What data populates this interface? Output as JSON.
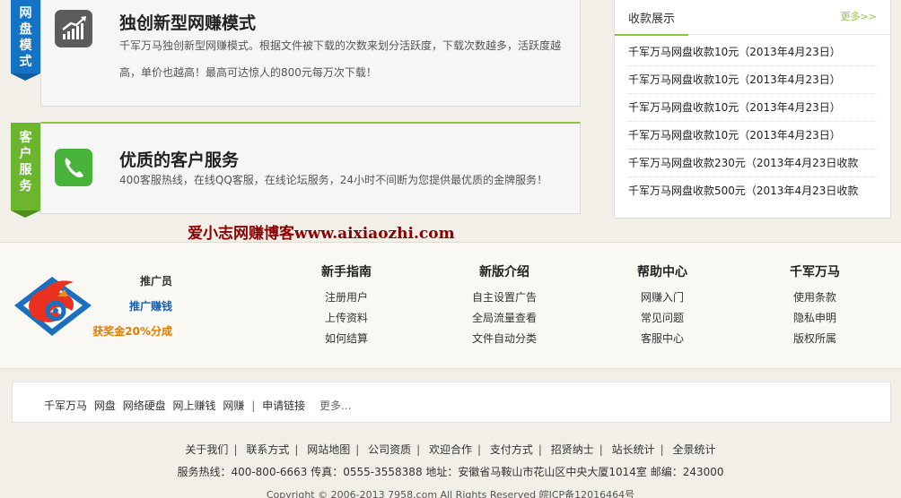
{
  "features": [
    {
      "ribbon": [
        "网",
        "盘",
        "模",
        "式"
      ],
      "title": "独创新型网赚模式",
      "desc": "千军万马独创新型网赚模式。根据文件被下载的次数来划分活跃度，下载次数越多，活跃度越高，单价也越高！最高可达惊人的800元每万次下载！"
    },
    {
      "ribbon": [
        "客",
        "户",
        "服",
        "务"
      ],
      "title": "优质的客户服务",
      "desc": "400客服热线，在线QQ客服，在线论坛服务，24小时不间断为您提供最优质的金牌服务！"
    }
  ],
  "panel": {
    "title": "收款展示",
    "more": "更多>>",
    "items": [
      "千军万马网盘收款10元（2013年4月23日）",
      "千军万马网盘收款10元（2013年4月23日）",
      "千军万马网盘收款10元（2013年4月23日）",
      "千军万马网盘收款10元（2013年4月23日）",
      "千军万马网盘收款230元（2013年4月23日收款",
      "千军万马网盘收款500元（2013年4月23日收款"
    ]
  },
  "watermark": "爱小志网赚博客www.aixiaozhi.com",
  "promo": {
    "line1": "推广员",
    "line2": "推广赚钱",
    "line3": "获奖金20%分成"
  },
  "columns": [
    {
      "title": "新手指南",
      "links": [
        "注册用户",
        "上传资料",
        "如何结算"
      ]
    },
    {
      "title": "新版介绍",
      "links": [
        "自主设置广告",
        "全局流量查看",
        "文件自动分类"
      ]
    },
    {
      "title": "帮助中心",
      "links": [
        "网赚入门",
        "常见问题",
        "客服中心"
      ]
    },
    {
      "title": "千军万马",
      "links": [
        "使用条款",
        "隐私申明",
        "版权所属"
      ]
    }
  ],
  "tags": {
    "items": [
      "千军万马",
      "网盘",
      "网络硬盘",
      "网上赚钱",
      "网赚"
    ],
    "separator": "|",
    "apply": "申请链接",
    "more": "更多..."
  },
  "bottom_links": [
    "关于我们",
    "联系方式",
    "网站地图",
    "公司资质",
    "欢迎合作",
    "支付方式",
    "招贤纳士",
    "站长统计",
    "全景统计"
  ],
  "bottom_separator": "|",
  "contact": "服务热线：400-800-6663 传真：0555-3558388 地址：安徽省马鞍山市花山区中央大厦1014室 邮编：243000",
  "copyright": "Copyright © 2006-2013 7958.com All Rights Reserved 皖ICP备12016464号",
  "colors": {
    "blue_ribbon": "#1573c6",
    "green_ribbon": "#6cb52f",
    "accent_green": "#8ec63f",
    "watermark": "#8b0000",
    "promo_blue": "#1a5fb4",
    "promo_orange": "#e07b00"
  },
  "icons": {
    "feature1": "chart-up-icon",
    "feature2": "phone-icon",
    "logo": "horse-logo-icon"
  }
}
